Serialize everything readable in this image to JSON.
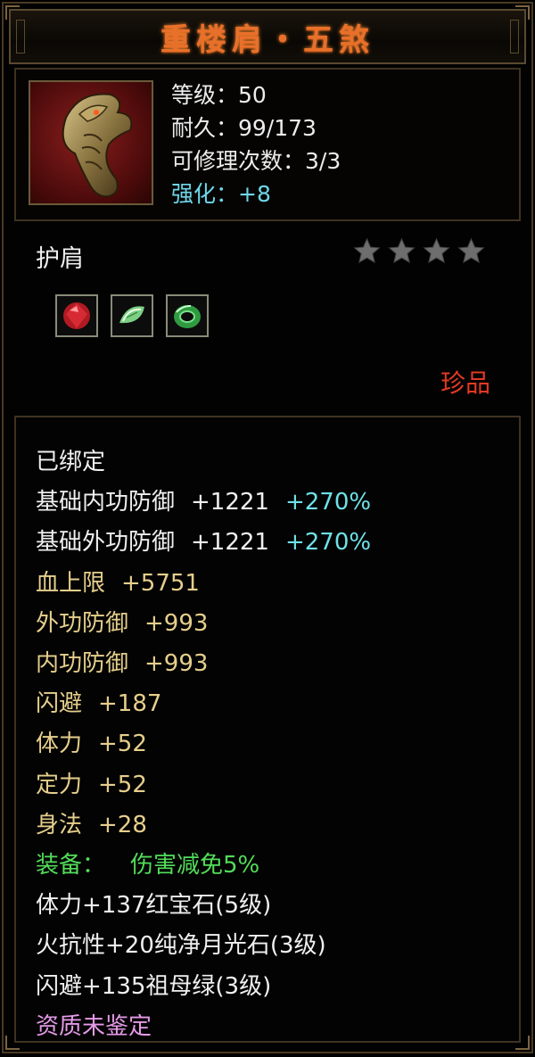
{
  "item": {
    "name": "重楼肩・五煞",
    "level_text": "等级：50",
    "durability_text": "耐久：99/173",
    "repair_text": "可修理次数：3/3",
    "enhance_text": "强化：+8",
    "type": "护肩",
    "stars": 4,
    "rarity": "珍品",
    "icon": "dragon-shoulder-armor-icon"
  },
  "gems": [
    {
      "icon": "ruby-gem-icon",
      "color": "#c8202a"
    },
    {
      "icon": "moonstone-gem-icon",
      "color": "#9ee0a0"
    },
    {
      "icon": "emerald-gem-icon",
      "color": "#3aa84a"
    }
  ],
  "stats": {
    "bound": "已绑定",
    "base_inner_def": {
      "label": "基础内功防御",
      "value": "+1221",
      "bonus": "+270%"
    },
    "base_outer_def": {
      "label": "基础外功防御",
      "value": "+1221",
      "bonus": "+270%"
    },
    "hp": {
      "label": "血上限",
      "value": "+5751"
    },
    "outer_def": {
      "label": "外功防御",
      "value": "+993"
    },
    "inner_def": {
      "label": "内功防御",
      "value": "+993"
    },
    "dodge": {
      "label": "闪避",
      "value": "+187"
    },
    "stamina": {
      "label": "体力",
      "value": "+52"
    },
    "focus": {
      "label": "定力",
      "value": "+52"
    },
    "agility": {
      "label": "身法",
      "value": "+28"
    },
    "equip_label": "装备：",
    "equip_effect": "伤害减免5%",
    "gem_line_1": "体力+137红宝石(5级)",
    "gem_line_2": "火抗性+20纯净月光石(3级)",
    "gem_line_3": "闪避+135祖母绿(3级)",
    "quality": "资质未鉴定"
  },
  "colors": {
    "title": "#e8702a",
    "enhance": "#6fd6e8",
    "gold_stat": "#e6cf8c",
    "bonus": "#6fe0e8",
    "equip": "#52dc5a",
    "quality": "#e59ae8",
    "rarity": "#e23a22"
  }
}
